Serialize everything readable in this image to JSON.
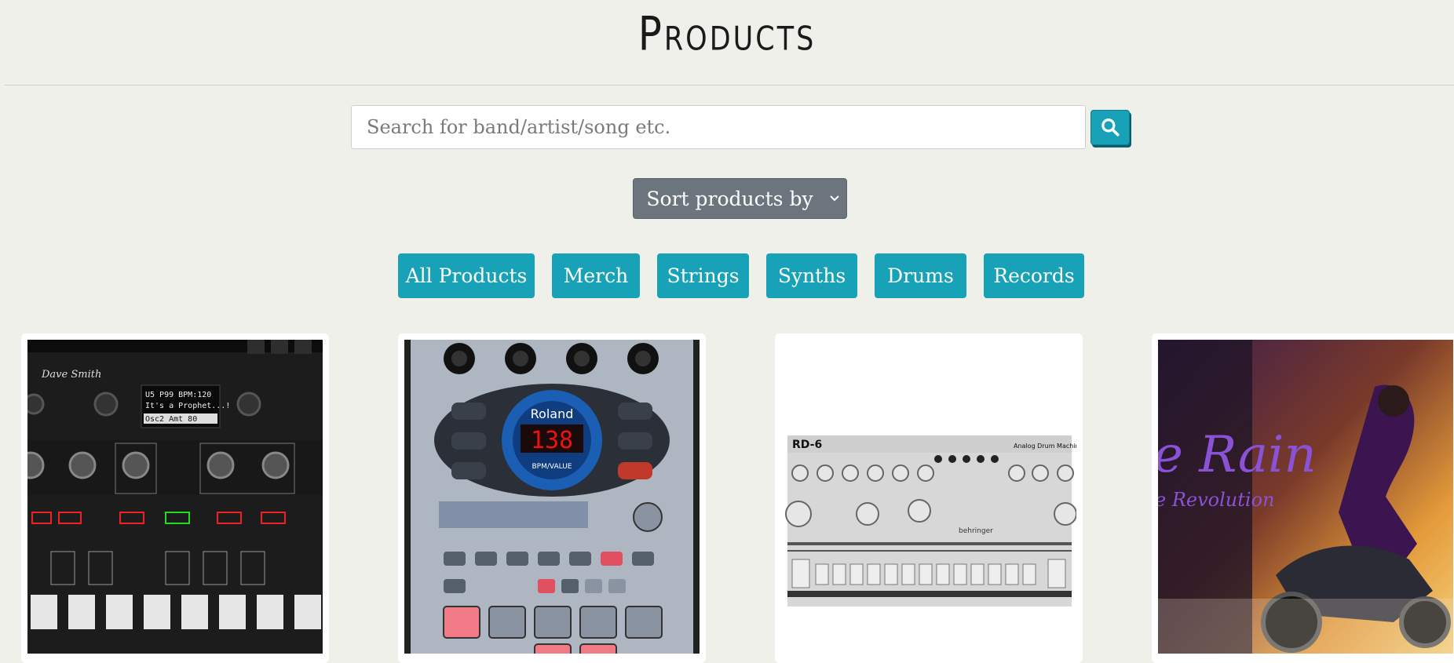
{
  "header": {
    "title": "Products"
  },
  "search": {
    "placeholder": "Search for band/artist/song etc."
  },
  "sort": {
    "label": "Sort products by"
  },
  "categories": [
    "All Products",
    "Merch",
    "Strings",
    "Synths",
    "Drums",
    "Records"
  ],
  "products": [
    {
      "image": "synth-keyboard-panel",
      "brand_text": "Dave Smith",
      "display": [
        "U5  P99  BPM:120",
        "It's a Prophet...!",
        "Osc2 Amt     80"
      ]
    },
    {
      "image": "roland-sampler",
      "brand_text": "Roland",
      "display": "138",
      "display_caption": "BPM/VALUE"
    },
    {
      "image": "rd6-drum-machine",
      "model_text": "RD-6",
      "brand_text": "behringer",
      "subtitle": "Analog Drum Machine"
    },
    {
      "image": "purple-rain-album-cover",
      "title_text": "e Rain",
      "subtitle_text": "e Revolution"
    }
  ],
  "colors": {
    "accent": "#17a2b8",
    "sort_bg": "#6c757d",
    "page_bg": "#f0f0ea"
  }
}
